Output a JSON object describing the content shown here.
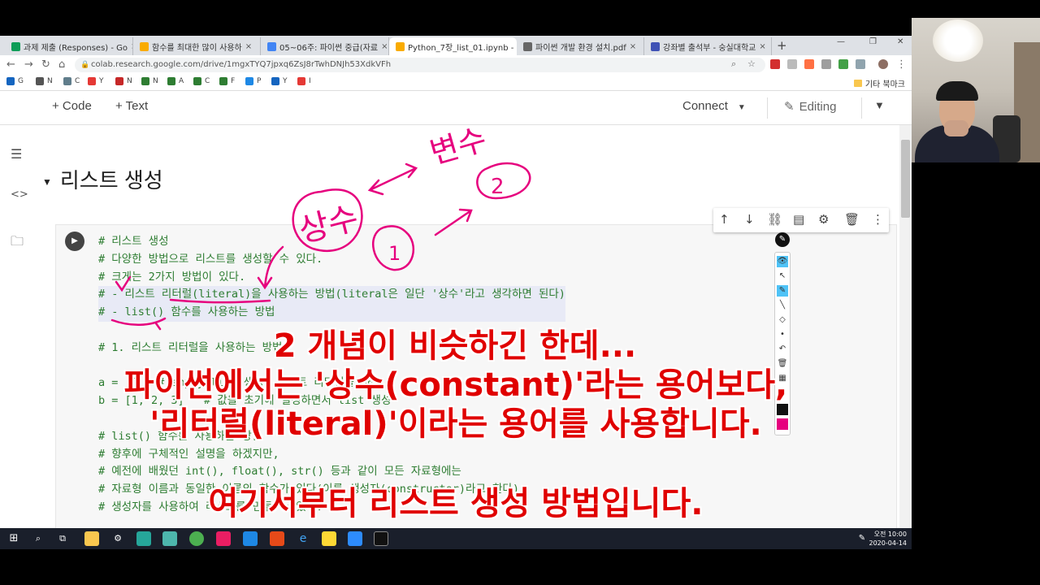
{
  "browser": {
    "tabs": [
      {
        "label": "과제 제출 (Responses) - Go",
        "color": "#0f9d58"
      },
      {
        "label": "함수를 최대한 많이 사용하",
        "color": "#f9ab00"
      },
      {
        "label": "05~06주: 파이썬 중급(자료",
        "color": "#4285f4"
      },
      {
        "label": "Python_7장_list_01.ipynb -",
        "color": "#f9ab00"
      },
      {
        "label": "파이썬 개발 환경 설치.pdf",
        "color": "#666666"
      },
      {
        "label": "강좌별 출석부 - 숭실대학교",
        "color": "#3f51b5"
      }
    ],
    "url": "colab.research.google.com/drive/1mgxTYQ7jpxq6ZsJ8rTwhDNJh53XdkVFh",
    "bookmarks": [
      "G",
      "N",
      "C",
      "Y",
      "N",
      "N",
      "A",
      "C",
      "F",
      "P",
      "Y",
      "I"
    ],
    "other_bookmarks": "기타 북마크"
  },
  "toolbar": {
    "add_code": "+ Code",
    "add_text": "+ Text",
    "connect": "Connect",
    "editing": "Editing"
  },
  "section": {
    "title": "리스트 생성"
  },
  "code_lines": [
    "# 리스트 생성",
    "# 다양한 방법으로 리스트를 생성할 수 있다.",
    "# 크게는 2가지 방법이 있다.",
    "# - 리스트 리터럴(literal)을 사용하는 방법(literal은 일단 '상수'라고 생각하면 된다)",
    "# - list() 함수를 사용하는 방법",
    "",
    "# 1. 리스트 리터럴을 사용하는 방법",
    "",
    "a = []   # empty list 생성. 리스트 리터럴을 사용",
    "b = [1, 2, 3]   # 값을 초기에 설정하면서 list 생성",
    "",
    "# list() 함수를 사용하는 방법",
    "# 향후에 구체적인 설명을 하겠지만,",
    "# 예전에 배웠던 int(), float(), str() 등과 같이 모든 자료형에는",
    "# 자료형 이름과 동일한 이름의 함수가 있다(이를 생성자(constructor)라고 한다)",
    "# 생성자를 사용하여 리스트를 만들 수 있다."
  ],
  "handwriting": {
    "word1": "상수",
    "word2": "변수",
    "circle_num": "1",
    "circle_num2": "2"
  },
  "captions": [
    "2 개념이 비슷하긴 한데...",
    "파이썬에서는 '상수(constant)'라는 용어보다,",
    "'리터럴(literal)'이라는 용어를 사용합니다.",
    "여기서부터 리스트 생성 방법입니다."
  ],
  "taskbar": {
    "time": "오전 10:00",
    "date": "2020-04-14"
  },
  "colors": {
    "annotation": "#e6007e",
    "caption": "#e00000",
    "comment": "#2e7d32"
  }
}
